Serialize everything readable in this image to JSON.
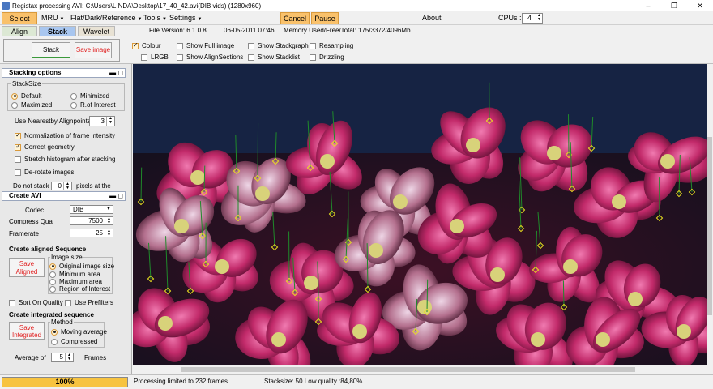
{
  "window": {
    "title": "Registax processing AVI: C:\\Users\\LINDA\\Desktop\\17_40_42.avi(DIB vids) (1280x960)",
    "controls": [
      "–",
      "❐",
      "✕"
    ]
  },
  "menu": {
    "select": "Select",
    "mru": "MRU",
    "flat": "Flat/Dark/Reference",
    "tools": "Tools",
    "settings": "Settings",
    "cancel": "Cancel",
    "pause": "Pause",
    "about": "About",
    "cpus_label": "CPUs :",
    "cpus_value": "4"
  },
  "tabs": {
    "align": "Align",
    "stack": "Stack",
    "wavelet": "Wavelet"
  },
  "info": {
    "file_version": "File Version: 6.1.0.8",
    "date": "06-05-2011 07:46",
    "memory": "Memory Used/Free/Total: 175/3372/4096Mb"
  },
  "toolbar": {
    "stack_button": "Stack",
    "save_image_button": "Save image",
    "checkboxes": [
      {
        "label": "Colour",
        "checked": true
      },
      {
        "label": "LRGB",
        "checked": false
      },
      {
        "label": "Show Full image",
        "checked": false
      },
      {
        "label": "Show AlignSections",
        "checked": false
      },
      {
        "label": "Show Stackgraph",
        "checked": false
      },
      {
        "label": "Show Stacklist",
        "checked": false
      },
      {
        "label": "Resampling",
        "checked": false
      },
      {
        "label": "Drizzling",
        "checked": false
      }
    ]
  },
  "stacking_options": {
    "title": "Stacking options",
    "stacksize_label": "StackSize",
    "radios": [
      {
        "label": "Default",
        "checked": true
      },
      {
        "label": "Minimized",
        "checked": false
      },
      {
        "label": "Maximized",
        "checked": false
      },
      {
        "label": "R.of Interest",
        "checked": false
      }
    ],
    "nearest_label": "Use Nearestby Alignpoints",
    "nearest_value": "3",
    "checks": [
      {
        "label": "Normalization of frame intensity",
        "checked": true
      },
      {
        "label": "Correct geometry",
        "checked": true
      },
      {
        "label": "Stretch histogram after stacking",
        "checked": false
      },
      {
        "label": "De-rotate images",
        "checked": false
      }
    ],
    "do_not_stack_label": "Do not stack",
    "do_not_stack_value": "0",
    "do_not_stack_suffix": "pixels at the"
  },
  "create_avi": {
    "title": "Create AVI",
    "codec_label": "Codec",
    "codec_value": "DIB",
    "compress_label": "Compress Qual",
    "compress_value": "7500",
    "framerate_label": "Framerate",
    "framerate_value": "25",
    "aligned_seq_title": "Create aligned Sequence",
    "save_aligned": "Save Aligned",
    "image_size_label": "Image size",
    "image_size_radios": [
      {
        "label": "Original image size",
        "checked": true
      },
      {
        "label": "Minimum area",
        "checked": false
      },
      {
        "label": "Maximum area",
        "checked": false
      },
      {
        "label": "Region of Interest",
        "checked": false
      }
    ],
    "sort_quality": "Sort On Quality",
    "use_prefilters": "Use Prefilters",
    "integrated_title": "Create integrated sequence",
    "save_integrated": "Save Integrated",
    "method_label": "Method",
    "method_radios": [
      {
        "label": "Moving average",
        "checked": true
      },
      {
        "label": "Compressed",
        "checked": false
      }
    ],
    "average_label": "Average of",
    "average_value": "5",
    "frames_label": "Frames"
  },
  "status": {
    "progress_text": "100%",
    "progress": 1.0,
    "processing": "Processing limited to 232 frames",
    "stacksize": "Stacksize: 50 Low quality :84,80%"
  },
  "colors": {
    "accent_orange": "#f9c16b",
    "tab_active": "#a8c6ef",
    "panel_title_red": "#e02020",
    "progress_fill": "#f7c340",
    "marker_yellow": "#e8e020",
    "track_green": "#1f8a2a"
  }
}
